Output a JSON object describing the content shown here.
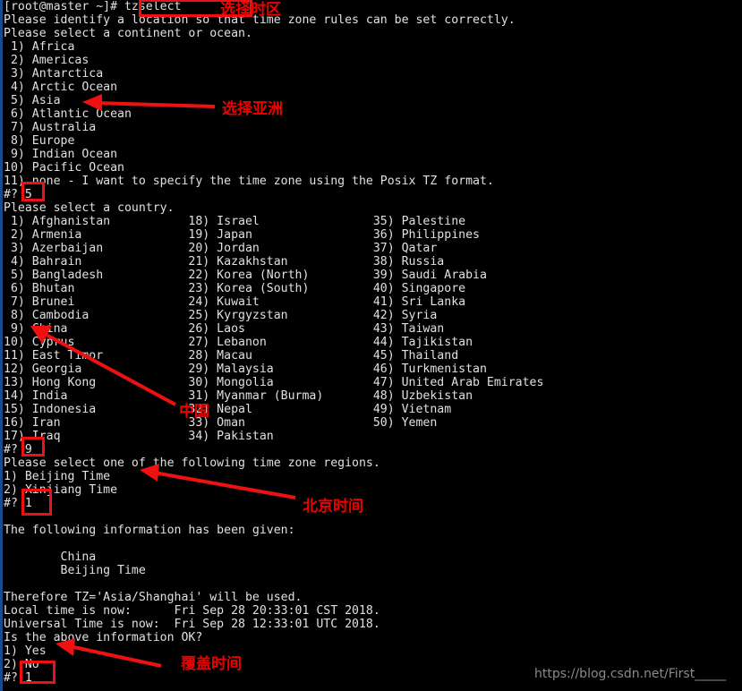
{
  "terminal": {
    "prompt": "[root@master ~]# ",
    "command": "tzselect",
    "lines": [
      "[root@master ~]# tzselect",
      "Please identify a location so that time zone rules can be set correctly.",
      "Please select a continent or ocean.",
      " 1) Africa",
      " 2) Americas",
      " 3) Antarctica",
      " 4) Arctic Ocean",
      " 5) Asia",
      " 6) Atlantic Ocean",
      " 7) Australia",
      " 8) Europe",
      " 9) Indian Ocean",
      "10) Pacific Ocean",
      "11) none - I want to specify the time zone using the Posix TZ format.",
      "#? 5",
      "Please select a country.",
      " 1) Afghanistan           18) Israel                35) Palestine",
      " 2) Armenia               19) Japan                 36) Philippines",
      " 3) Azerbaijan            20) Jordan                37) Qatar",
      " 4) Bahrain               21) Kazakhstan            38) Russia",
      " 5) Bangladesh            22) Korea (North)         39) Saudi Arabia",
      " 6) Bhutan                23) Korea (South)         40) Singapore",
      " 7) Brunei                24) Kuwait                41) Sri Lanka",
      " 8) Cambodia              25) Kyrgyzstan            42) Syria",
      " 9) China                 26) Laos                  43) Taiwan",
      "10) Cyprus                27) Lebanon               44) Tajikistan",
      "11) East Timor            28) Macau                 45) Thailand",
      "12) Georgia               29) Malaysia              46) Turkmenistan",
      "13) Hong Kong             30) Mongolia              47) United Arab Emirates",
      "14) India                 31) Myanmar (Burma)       48) Uzbekistan",
      "15) Indonesia             32) Nepal                 49) Vietnam",
      "16) Iran                  33) Oman                  50) Yemen",
      "17) Iraq                  34) Pakistan",
      "#? 9",
      "Please select one of the following time zone regions.",
      "1) Beijing Time",
      "2) Xinjiang Time",
      "#? 1",
      "",
      "The following information has been given:",
      "",
      "        China",
      "        Beijing Time",
      "",
      "Therefore TZ='Asia/Shanghai' will be used.",
      "Local time is now:      Fri Sep 28 20:33:01 CST 2018.",
      "Universal Time is now:  Fri Sep 28 12:33:01 UTC 2018.",
      "Is the above information OK?",
      "1) Yes",
      "2) No",
      "#? 1"
    ]
  },
  "continents": [
    {
      "num": "1)",
      "name": "Africa"
    },
    {
      "num": "2)",
      "name": "Americas"
    },
    {
      "num": "3)",
      "name": "Antarctica"
    },
    {
      "num": "4)",
      "name": "Arctic Ocean"
    },
    {
      "num": "5)",
      "name": "Asia"
    },
    {
      "num": "6)",
      "name": "Atlantic Ocean"
    },
    {
      "num": "7)",
      "name": "Australia"
    },
    {
      "num": "8)",
      "name": "Europe"
    },
    {
      "num": "9)",
      "name": "Indian Ocean"
    },
    {
      "num": "10)",
      "name": "Pacific Ocean"
    },
    {
      "num": "11)",
      "name": "none - I want to specify the time zone using the Posix TZ format."
    }
  ],
  "countries": [
    "Afghanistan",
    "Armenia",
    "Azerbaijan",
    "Bahrain",
    "Bangladesh",
    "Bhutan",
    "Brunei",
    "Cambodia",
    "China",
    "Cyprus",
    "East Timor",
    "Georgia",
    "Hong Kong",
    "India",
    "Indonesia",
    "Iran",
    "Iraq",
    "Israel",
    "Japan",
    "Jordan",
    "Kazakhstan",
    "Korea (North)",
    "Korea (South)",
    "Kuwait",
    "Kyrgyzstan",
    "Laos",
    "Lebanon",
    "Macau",
    "Malaysia",
    "Mongolia",
    "Myanmar (Burma)",
    "Nepal",
    "Oman",
    "Pakistan",
    "Palestine",
    "Philippines",
    "Qatar",
    "Russia",
    "Saudi Arabia",
    "Singapore",
    "Sri Lanka",
    "Syria",
    "Taiwan",
    "Tajikistan",
    "Thailand",
    "Turkmenistan",
    "United Arab Emirates",
    "Uzbekistan",
    "Vietnam",
    "Yemen"
  ],
  "regions": [
    {
      "num": "1)",
      "name": "Beijing Time"
    },
    {
      "num": "2)",
      "name": "Xinjiang Time"
    }
  ],
  "confirm": [
    {
      "num": "1)",
      "name": "Yes"
    },
    {
      "num": "2)",
      "name": "No"
    }
  ],
  "answers": {
    "continent": "5",
    "country": "9",
    "region": "1",
    "confirm": "1"
  },
  "summary": {
    "heading": "The following information has been given:",
    "country": "China",
    "region": "Beijing Time",
    "tz_line": "Therefore TZ='Asia/Shanghai' will be used.",
    "local_time": "Local time is now:      Fri Sep 28 20:33:01 CST 2018.",
    "universal_time": "Universal Time is now:  Fri Sep 28 12:33:01 UTC 2018.",
    "question": "Is the above information OK?"
  },
  "annotations": {
    "a1": "选择时区",
    "a2": "选择亚洲",
    "a3": "中国",
    "a4": "北京时间",
    "a5": "覆盖时间"
  },
  "watermark": "https://blog.csdn.net/First_____",
  "colors": {
    "background": "#000000",
    "text": "#d8d8d8",
    "annotation": "#ee0000",
    "watermark": "#8a8a8a",
    "window_edge": "#1a4b8c"
  }
}
